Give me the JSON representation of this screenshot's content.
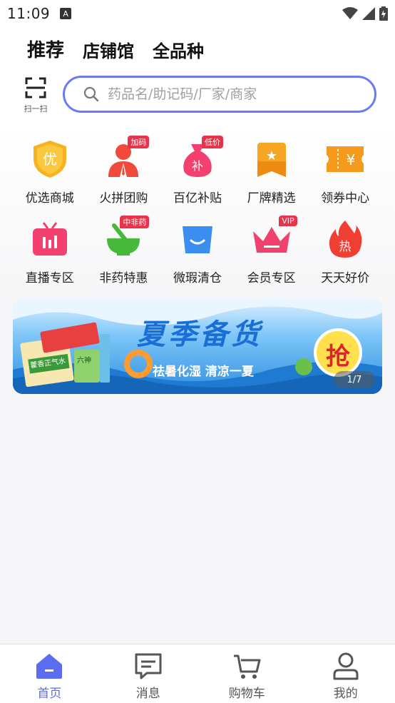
{
  "status_bar": {
    "time": "11:09"
  },
  "top_tabs": [
    {
      "label": "推荐",
      "active": true
    },
    {
      "label": "店铺馆",
      "active": false
    },
    {
      "label": "全品种",
      "active": false
    }
  ],
  "scan": {
    "label": "扫一扫",
    "icon": "scan-icon"
  },
  "search": {
    "placeholder": "药品名/助记码/厂家/商家",
    "icon": "search-icon"
  },
  "categories": [
    {
      "label": "优选商城",
      "icon": "shield-icon",
      "icon_glyph": "优",
      "color": "#f6b221",
      "badge": ""
    },
    {
      "label": "火拼团购",
      "icon": "group-buy-icon",
      "icon_glyph": "",
      "color": "#ef4a3a",
      "badge": "加码"
    },
    {
      "label": "百亿补贴",
      "icon": "money-bag-icon",
      "icon_glyph": "补",
      "color": "#f2416e",
      "badge": "低价"
    },
    {
      "label": "厂牌精选",
      "icon": "star-ribbon-icon",
      "icon_glyph": "★",
      "color": "#f6a623",
      "badge": ""
    },
    {
      "label": "领券中心",
      "icon": "coupon-icon",
      "icon_glyph": "¥",
      "color": "#f59a1b",
      "badge": ""
    },
    {
      "label": "直播专区",
      "icon": "tv-icon",
      "icon_glyph": "",
      "color": "#f2416e",
      "badge": ""
    },
    {
      "label": "非药特惠",
      "icon": "mortar-icon",
      "icon_glyph": "",
      "color": "#46b83a",
      "badge": "中非药"
    },
    {
      "label": "微瑕清仓",
      "icon": "shopping-bag-icon",
      "icon_glyph": "",
      "color": "#3b8df0",
      "badge": ""
    },
    {
      "label": "会员专区",
      "icon": "crown-icon",
      "icon_glyph": "",
      "color": "#f2416e",
      "badge": "VIP"
    },
    {
      "label": "天天好价",
      "icon": "fire-icon",
      "icon_glyph": "热",
      "color": "#ef3f35",
      "badge": ""
    }
  ],
  "banner": {
    "title": "夏季备货",
    "subtitle": "祛暑化湿 清凉一夏",
    "cta": "抢",
    "pager": "1/7",
    "products": [
      "藿香正气水",
      "六神"
    ]
  },
  "bottom_nav": [
    {
      "label": "首页",
      "icon": "home-icon",
      "active": true
    },
    {
      "label": "消息",
      "icon": "message-icon",
      "active": false
    },
    {
      "label": "购物车",
      "icon": "cart-icon",
      "active": false
    },
    {
      "label": "我的",
      "icon": "user-icon",
      "active": false
    }
  ],
  "colors": {
    "accent": "#5b6cf0",
    "search_border": "#6a7cf3"
  }
}
